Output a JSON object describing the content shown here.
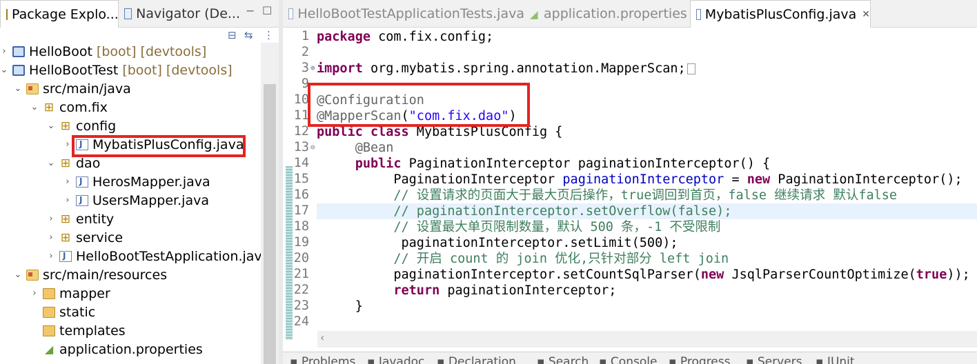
{
  "left_tabs": [
    {
      "label": "Package Explo...",
      "icon": "package-explorer-icon"
    },
    {
      "label": "Navigator (De...",
      "icon": "navigator-icon"
    }
  ],
  "window_controls": {
    "minimize": "−",
    "maximize": "☐"
  },
  "tree": [
    {
      "label": "HelloBoot",
      "decor": "[boot] [devtools]",
      "icon": "project-icon",
      "twisty": "›"
    },
    {
      "label": "HelloBootTest",
      "decor": "[boot] [devtools]",
      "icon": "project-icon",
      "twisty": "⌄"
    },
    {
      "label": "src/main/java",
      "icon": "source-folder-icon",
      "twisty": "⌄"
    },
    {
      "label": "com.fix",
      "icon": "package-icon",
      "twisty": "⌄"
    },
    {
      "label": "config",
      "icon": "package-icon",
      "twisty": "⌄"
    },
    {
      "label": "MybatisPlusConfig.java",
      "icon": "java-file-icon",
      "twisty": "›"
    },
    {
      "label": "dao",
      "icon": "package-icon",
      "twisty": "⌄"
    },
    {
      "label": "HerosMapper.java",
      "icon": "java-interface-icon",
      "twisty": "›"
    },
    {
      "label": "UsersMapper.java",
      "icon": "java-interface-icon",
      "twisty": "›"
    },
    {
      "label": "entity",
      "icon": "package-icon",
      "twisty": "›"
    },
    {
      "label": "service",
      "icon": "package-icon",
      "twisty": "›"
    },
    {
      "label": "HelloBootTestApplication.java",
      "icon": "java-file-icon",
      "twisty": "›"
    },
    {
      "label": "src/main/resources",
      "icon": "source-folder-icon",
      "twisty": "⌄"
    },
    {
      "label": "mapper",
      "icon": "folder-icon",
      "twisty": "›"
    },
    {
      "label": "static",
      "icon": "folder-icon",
      "twisty": ""
    },
    {
      "label": "templates",
      "icon": "folder-icon",
      "twisty": ""
    },
    {
      "label": "application.properties",
      "icon": "properties-file-icon",
      "twisty": ""
    }
  ],
  "editor_tabs": [
    {
      "label": "HelloBootTestApplicationTests.java",
      "icon": "java-file-icon"
    },
    {
      "label": "application.properties",
      "icon": "properties-file-icon"
    },
    {
      "label": "MybatisPlusConfig.java",
      "icon": "java-file-icon",
      "active": true
    }
  ],
  "code_lines": [
    {
      "n": "1",
      "html": "<span class=\"kw\">package</span> com.fix.config;"
    },
    {
      "n": "2",
      "html": ""
    },
    {
      "n": "3",
      "html": "<span class=\"kw\">import</span> org.mybatis.spring.annotation.MapperScan;<span class=\"fold-box\"></span>",
      "fold": "⊕"
    },
    {
      "n": "9",
      "html": ""
    },
    {
      "n": "10",
      "html": "<span class=\"ann\">@Configuration</span>"
    },
    {
      "n": "11",
      "html": "<span class=\"ann\">@MapperScan</span>(<span class=\"str\">\"com.fix.dao\"</span>)"
    },
    {
      "n": "12",
      "html": "<span class=\"kw\">public</span> <span class=\"kw\">class</span> MybatisPlusConfig {"
    },
    {
      "n": "13",
      "html": "     <span class=\"ann\">@Bean</span>",
      "fold": "⊖"
    },
    {
      "n": "14",
      "html": "     <span class=\"kw\">public</span> PaginationInterceptor paginationInterceptor() {"
    },
    {
      "n": "15",
      "html": "          PaginationInterceptor <span class=\"fld\">paginationInterceptor</span> = <span class=\"kw\">new</span> PaginationInterceptor();"
    },
    {
      "n": "16",
      "html": "          <span class=\"cmt\">// 设置请求的页面大于最大页后操作，true调回到首页，false 继续请求 默认false</span>"
    },
    {
      "n": "17",
      "html": "          <span class=\"cmt\">// paginationInterceptor.setOverflow(false);</span>",
      "highlight": true
    },
    {
      "n": "18",
      "html": "          <span class=\"cmt\">// 设置最大单页限制数量，默认 500 条，-1 不受限制</span>"
    },
    {
      "n": "19",
      "html": "           paginationInterceptor.setLimit(500);"
    },
    {
      "n": "20",
      "html": "          <span class=\"cmt\">// 开启 count 的 join 优化,只针对部分 left join</span>"
    },
    {
      "n": "21",
      "html": "          paginationInterceptor.setCountSqlParser(<span class=\"kw\">new</span> JsqlParserCountOptimize(<span class=\"kw\">true</span>));"
    },
    {
      "n": "22",
      "html": "          <span class=\"kw\">return</span> paginationInterceptor;"
    },
    {
      "n": "23",
      "html": "     }"
    },
    {
      "n": "24",
      "html": ""
    }
  ],
  "bottom_tabs": [
    "Problems",
    "Javadoc",
    "Declaration",
    "Search",
    "Console",
    "Progress",
    "Servers",
    "JUnit"
  ]
}
